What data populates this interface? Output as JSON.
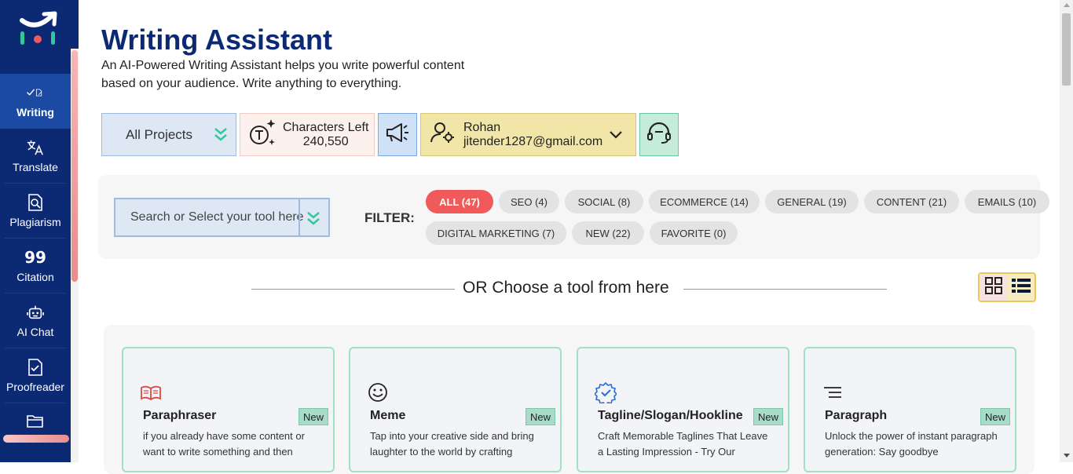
{
  "sidebar": {
    "items": [
      {
        "label": "Writing",
        "icon": "writing-check-icon",
        "active": true
      },
      {
        "label": "Translate",
        "icon": "translate-icon"
      },
      {
        "label": "Plagiarism",
        "icon": "plagiarism-search-icon"
      },
      {
        "label": "Citation",
        "icon": "quote-icon"
      },
      {
        "label": "AI Chat",
        "icon": "robot-icon"
      },
      {
        "label": "Proofreader",
        "icon": "proofread-icon"
      },
      {
        "label": "",
        "icon": "folder-icon"
      }
    ]
  },
  "header": {
    "title": "Writing Assistant",
    "subtitle": "An AI-Powered Writing Assistant helps you write powerful content based on your audience. Write anything to everything."
  },
  "toolbar": {
    "projects_label": "All Projects",
    "characters_label": "Characters Left",
    "characters_value": "240,550",
    "user_name": "Rohan",
    "user_email": "jitender1287@gmail.com"
  },
  "filter": {
    "search_placeholder": "Search or Select your tool here",
    "label": "FILTER:",
    "pills": [
      {
        "label": "ALL (47)",
        "active": true
      },
      {
        "label": "SEO (4)"
      },
      {
        "label": "SOCIAL (8)"
      },
      {
        "label": "ECOMMERCE (14)"
      },
      {
        "label": "GENERAL (19)"
      },
      {
        "label": "CONTENT (21)"
      },
      {
        "label": "EMAILS (10)"
      },
      {
        "label": "DIGITAL MARKETING (7)"
      },
      {
        "label": "NEW (22)"
      },
      {
        "label": "FAVORITE (0)"
      }
    ]
  },
  "choose": {
    "text": "OR Choose a tool from here"
  },
  "cards": [
    {
      "title": "Paraphraser",
      "badge": "New",
      "desc": "if you already have some content or want to write something and then",
      "icon": "book-icon"
    },
    {
      "title": "Meme",
      "badge": "New",
      "desc": "Tap into your creative side and bring laughter to the world by crafting",
      "icon": "smiley-icon"
    },
    {
      "title": "Tagline/Slogan/Hookline",
      "badge": "New",
      "desc": "Craft Memorable Taglines That Leave a Lasting Impression - Try Our",
      "icon": "verified-badge-icon"
    },
    {
      "title": "Paragraph",
      "badge": "New",
      "desc": "Unlock the power of instant paragraph generation: Say goodbye",
      "icon": "paragraph-lines-icon"
    }
  ],
  "colors": {
    "sidebar_bg": "#0c2a74",
    "title": "#0c2a74",
    "active_pill": "#f05a5a",
    "card_border": "#9fe0c6"
  }
}
